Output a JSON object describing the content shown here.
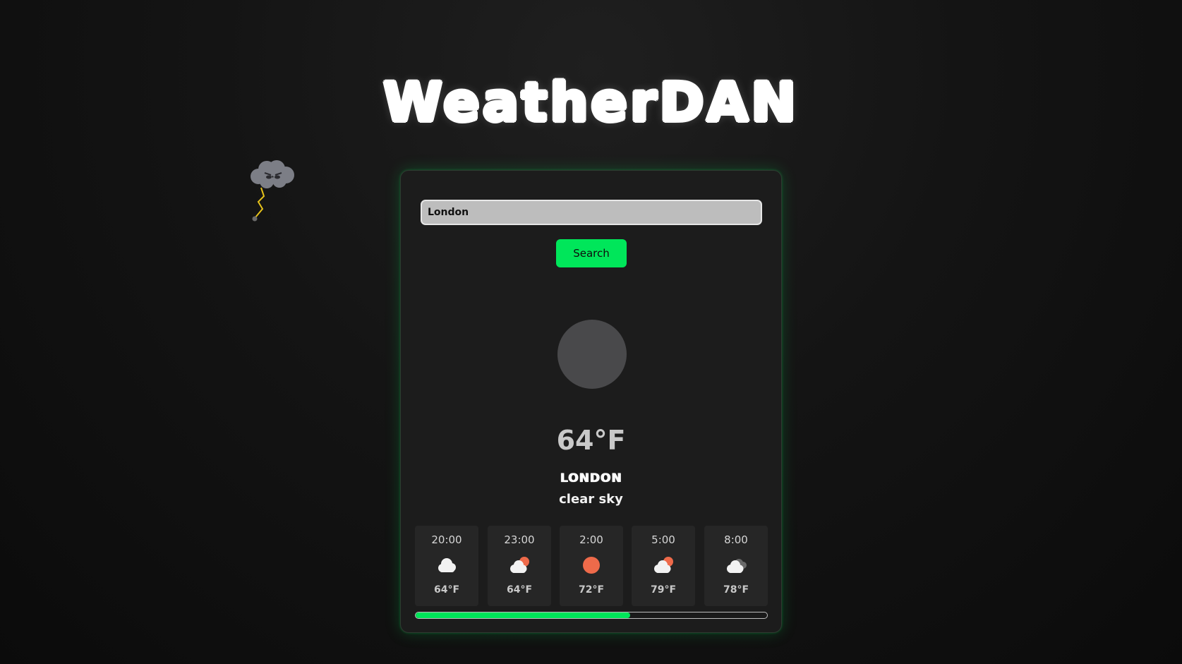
{
  "app": {
    "title": "WeatherDAN"
  },
  "search": {
    "value": "London",
    "placeholder": "",
    "button_label": "Search"
  },
  "current": {
    "icon": "blank-circle-icon",
    "temperature": "64°F",
    "city": "LONDON",
    "description": "clear sky"
  },
  "forecast": [
    {
      "time": "20:00",
      "icon": "cloud-icon",
      "temp": "64°F"
    },
    {
      "time": "23:00",
      "icon": "cloud-sun-icon",
      "temp": "64°F"
    },
    {
      "time": "2:00",
      "icon": "sun-icon",
      "temp": "72°F"
    },
    {
      "time": "5:00",
      "icon": "cloud-sun-icon",
      "temp": "79°F"
    },
    {
      "time": "8:00",
      "icon": "cloud-dark-icon",
      "temp": "78°F"
    }
  ],
  "progress": {
    "fraction": 0.61
  },
  "colors": {
    "accent": "#00e65a",
    "sun": "#ee6a4a",
    "cloud": "#f2f2f2",
    "background": "#141414",
    "card": "#1c1c1c"
  },
  "mascot": {
    "icon": "storm-cloud-mascot-icon"
  }
}
